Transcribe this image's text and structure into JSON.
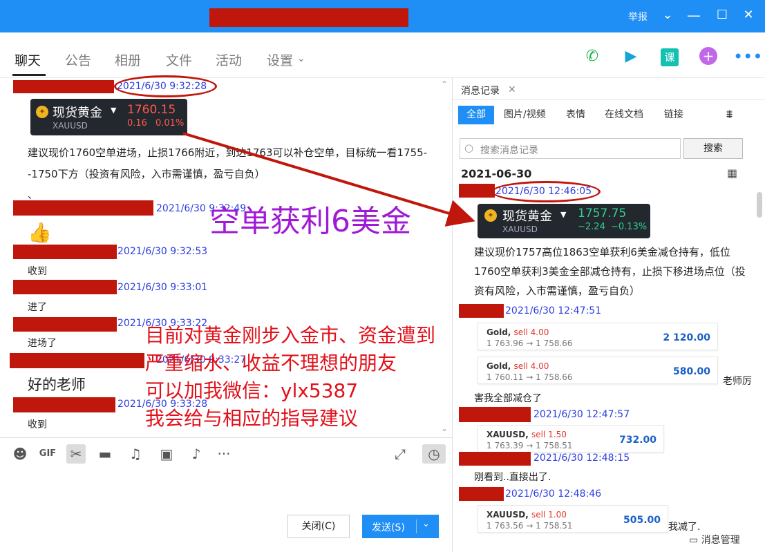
{
  "titlebar": {
    "report": "举报"
  },
  "tabs": [
    "聊天",
    "公告",
    "相册",
    "文件",
    "活动",
    "设置"
  ],
  "chat": {
    "ts1": "2021/6/30 9:32:28",
    "card1": {
      "name": "现货黄金",
      "code": "XAUUSD",
      "price": "1760.15",
      "change": "0.16",
      "pct": "0.01%"
    },
    "text1": "建议现价1760空单进场，止损1766附近，到达1763可以补仓空单，目标统一看1755--1750下方（投资有风险，入市需谨慎，盈亏自负）",
    "text1b": "、",
    "ts2": "2021/6/30 9:32:49",
    "ts3": "2021/6/30 9:32:53",
    "m3": "收到",
    "ts4": "2021/6/30 9:33:01",
    "m4": "进了",
    "ts5": "2021/6/30 9:33:22",
    "m5": "进场了",
    "ts6": "2021/6/30 9:33:27",
    "m6": "好的老师",
    "ts7": "2021/6/30 9:33:28",
    "m7": "收到"
  },
  "buttons": {
    "close": "关闭(C)",
    "send": "发送(S)"
  },
  "history": {
    "tab": "消息记录",
    "filters": [
      "全部",
      "图片/视频",
      "表情",
      "在线文档",
      "链接"
    ],
    "search_placeholder": "搜索消息记录",
    "search_btn": "搜索",
    "date": "2021-06-30",
    "ts1": "2021/6/30 12:46:05",
    "card": {
      "name": "现货黄金",
      "code": "XAUUSD",
      "price": "1757.75",
      "change": "−2.24",
      "pct": "−0.13%"
    },
    "text1": "建议现价1757高位1863空单获利6美金减仓持有，低位1760空单获利3美金全部减仓持有，止损下移进场点位（投资有风险，入市需谨慎，盈亏自负）",
    "ts2": "2021/6/30 12:47:51",
    "trade1": {
      "sym": "Gold",
      "side": "sell 4.00",
      "path": "1 763.96 → 1 758.66",
      "value": "2 120.00"
    },
    "trade2": {
      "sym": "Gold",
      "side": "sell 4.00",
      "path": "1 760.11 → 1 758.66",
      "value": "580.00"
    },
    "side_note": "老师厉",
    "m2": "害我全部减仓了",
    "ts3": "2021/6/30 12:47:57",
    "trade3": {
      "sym": "XAUUSD",
      "side": "sell 1.50",
      "path": "1 763.39 → 1 758.51",
      "value": "732.00"
    },
    "ts4": "2021/6/30 12:48:15",
    "m4": "刚看到..直接出了.",
    "ts5": "2021/6/30 12:48:46",
    "trade4": {
      "sym": "XAUUSD",
      "side": "sell 1.00",
      "path": "1 763.56 → 1 758.51",
      "value": "505.00"
    },
    "m5": "我减了.",
    "manage": "消息管理"
  },
  "overlay": {
    "purple": "空单获利6美金",
    "red_lines": [
      "目前对黄金刚步入金市、资金遭到",
      "严重缩水、收益不理想的朋友",
      "可以加我微信：ylx5387",
      "我会给与相应的指导建议"
    ]
  },
  "colors": {
    "brand": "#1f8ef5",
    "redact": "#c0170d",
    "overlay_purple": "#a019d6",
    "overlay_red": "#e3101a"
  }
}
